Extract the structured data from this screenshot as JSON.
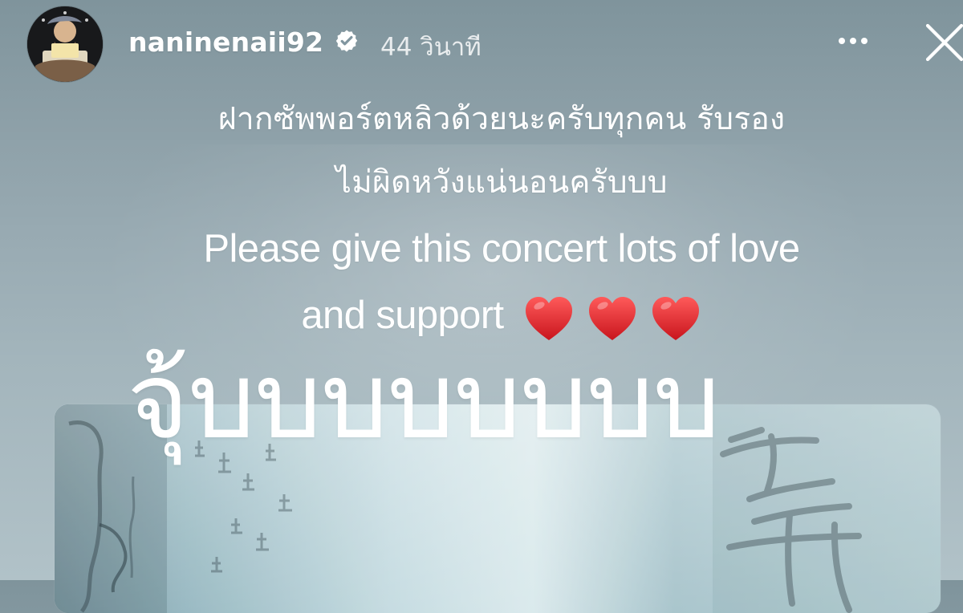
{
  "story": {
    "username": "naninenaii92",
    "timestamp": "44 วินาที",
    "caption": {
      "thai_line_1": "ฝากซัพพอร์ตหลิวด้วยนะครับทุกคน รับรอง",
      "thai_line_2": "ไม่ผิดหวังแน่นอนครับบบ",
      "english_line_1": "Please give this concert lots of love",
      "english_line_2": "and support"
    },
    "sticker_text": "จุ้บบบบบบบบ",
    "icons": {
      "verified": "verified-badge-icon",
      "more": "more-options-icon",
      "close": "close-icon",
      "heart": "red-heart-icon"
    },
    "colors": {
      "text_primary": "#ffffff",
      "heart": "#d61f2a"
    }
  }
}
